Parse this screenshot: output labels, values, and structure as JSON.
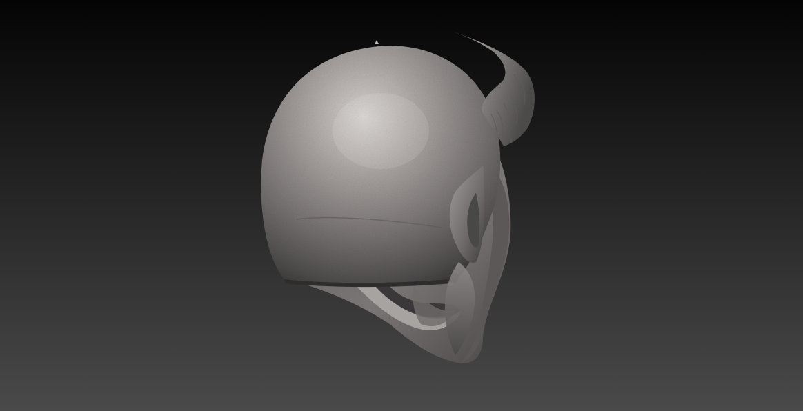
{
  "viewport": {
    "background_top": "#040404",
    "background_bottom": "#4a4a4a"
  },
  "model": {
    "subject": "horned-helmet-sculpt",
    "base_color": "#8a8685",
    "highlight_color": "#d2cecb",
    "shadow_color": "#2a2828"
  }
}
